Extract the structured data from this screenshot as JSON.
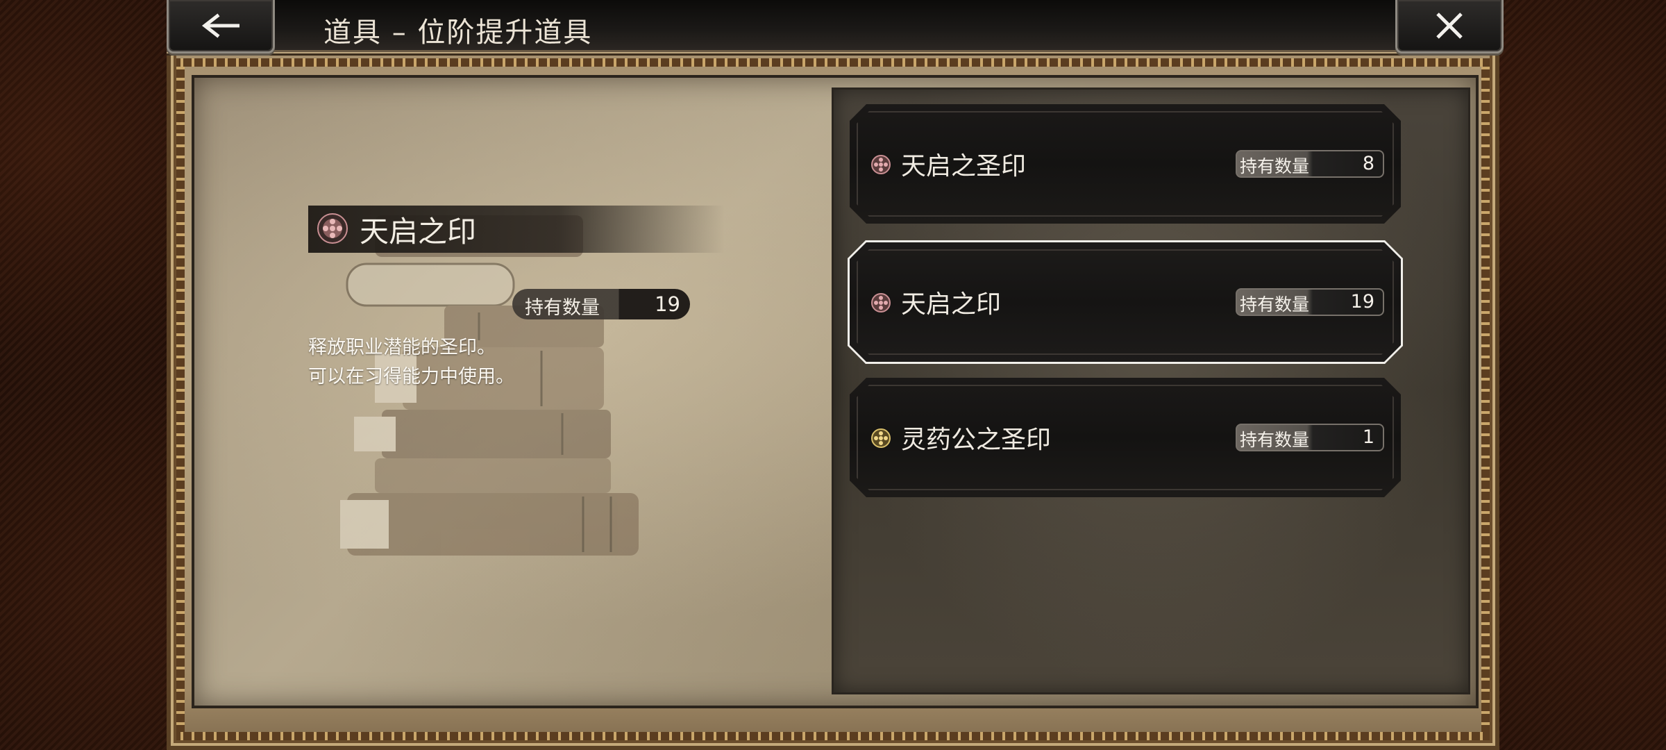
{
  "header": {
    "title": "道具 – 位阶提升道具",
    "back_icon": "arrow-left-icon",
    "close_icon": "close-icon"
  },
  "detail": {
    "name": "天启之印",
    "quantity_label": "持有数量",
    "quantity_value": "19",
    "description_line1": "释放职业潜能的圣印。",
    "description_line2": "可以在习得能力中使用。",
    "icon": "seal-icon"
  },
  "items": [
    {
      "name": "天启之圣印",
      "quantity_label": "持有数量",
      "quantity_value": "8",
      "icon": "seal-icon",
      "icon_color": "#c98f93",
      "selected": false
    },
    {
      "name": "天启之印",
      "quantity_label": "持有数量",
      "quantity_value": "19",
      "icon": "seal-icon",
      "icon_color": "#c98f93",
      "selected": true
    },
    {
      "name": "灵药公之圣印",
      "quantity_label": "持有数量",
      "quantity_value": "1",
      "icon": "seal-icon",
      "icon_color": "#d9bf6a",
      "selected": false
    }
  ],
  "colors": {
    "selected_outline": "#f1efea",
    "text_light": "#f0ebe2",
    "header_bg": "#151413"
  }
}
